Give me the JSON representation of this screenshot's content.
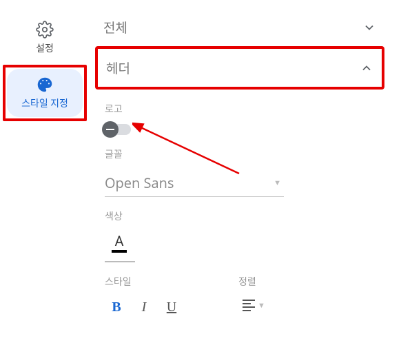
{
  "sidebar": {
    "settings": {
      "label": "설정"
    },
    "style": {
      "label": "스타일 지정"
    }
  },
  "sections": {
    "global": {
      "label": "전체"
    },
    "header": {
      "label": "헤더"
    }
  },
  "header_panel": {
    "logo_label": "로고",
    "font_label": "글꼴",
    "font_value": "Open Sans",
    "color_label": "색상",
    "color_letter": "A",
    "style_label": "스타일",
    "align_label": "정렬",
    "bold": "B",
    "italic": "I",
    "underline": "U"
  }
}
